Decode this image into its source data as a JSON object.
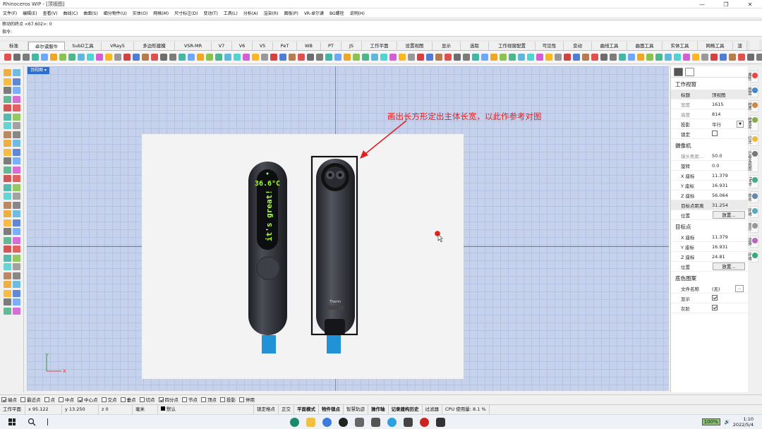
{
  "window": {
    "title": "Rhinoceros WIP - [顶视图]",
    "minimize": "—",
    "restore": "❐",
    "close": "✕"
  },
  "menu": [
    "文件(F)",
    "编辑(E)",
    "查看(V)",
    "曲线(C)",
    "曲面(S)",
    "细分物件(U)",
    "实体(O)",
    "网格(M)",
    "尺寸标注(D)",
    "变动(T)",
    "工具(L)",
    "分析(A)",
    "渲染(R)",
    "面板(P)",
    "VR-卓尔谟",
    "BG螺栓",
    "说明(H)"
  ],
  "command": {
    "history": "移动的终点 <67.602>: 0",
    "prompt": "指令:"
  },
  "tabs": [
    "标准",
    "卓尔谟服牛",
    "SubD工具",
    "VRay5",
    "多边形建模",
    "VSR-MR",
    "V7",
    "V6",
    "V5",
    "PeT",
    "WB",
    "PT",
    "JS",
    "工作平面",
    "设置视图",
    "显示",
    "选取",
    "工作视窗配置",
    "可见性",
    "变动",
    "曲线工具",
    "曲面工具",
    "实体工具",
    "网格工具",
    "渲"
  ],
  "viewport": {
    "label": "顶视图 ▾",
    "note": "画出长方形定出主体长宽，以此作参考对图"
  },
  "device": {
    "temp": "36.6°C",
    "message": "it's great!",
    "brand": "Therm"
  },
  "axes": {
    "x": "x",
    "y": "y"
  },
  "panel": {
    "viewport_section": "工作视窗",
    "viewport_rows": [
      {
        "k": "标题",
        "v": "顶视图"
      },
      {
        "k": "宽度",
        "v": "1615"
      },
      {
        "k": "高度",
        "v": "814"
      },
      {
        "k": "投影",
        "v": "平行"
      },
      {
        "k": "锁定",
        "v": ""
      }
    ],
    "camera_section": "摄像机",
    "camera_rows": [
      {
        "k": "镜头焦距...",
        "v": "50.0"
      },
      {
        "k": "旋转",
        "v": "0.0"
      },
      {
        "k": "X 座标",
        "v": "11.379"
      },
      {
        "k": "Y 座标",
        "v": "16.931"
      },
      {
        "k": "Z 座标",
        "v": "56.064"
      },
      {
        "k": "目标点距离",
        "v": "31.254"
      },
      {
        "k": "位置",
        "v": "放置..."
      }
    ],
    "target_section": "目标点",
    "target_rows": [
      {
        "k": "X 座标",
        "v": "11.379"
      },
      {
        "k": "Y 座标",
        "v": "16.931"
      },
      {
        "k": "Z 座标",
        "v": "24.81"
      },
      {
        "k": "位置",
        "v": "放置..."
      }
    ],
    "bg_section": "底色图案",
    "bg_rows": [
      {
        "k": "文件名称",
        "v": "(无)"
      },
      {
        "k": "显示",
        "v": ""
      },
      {
        "k": "灰阶",
        "v": ""
      }
    ],
    "ellipsis": "..."
  },
  "vtabs": [
    "属性",
    "图层",
    "材质",
    "材质库",
    "灯光",
    "已命名视图",
    "Help",
    "命名",
    "环境",
    "显示",
    "渲染",
    "环境"
  ],
  "osnaps": [
    {
      "label": "端点",
      "on": true
    },
    {
      "label": "最近点",
      "on": false
    },
    {
      "label": "点",
      "on": false
    },
    {
      "label": "中点",
      "on": false
    },
    {
      "label": "中心点",
      "on": true
    },
    {
      "label": "交点",
      "on": false
    },
    {
      "label": "垂点",
      "on": false
    },
    {
      "label": "切点",
      "on": false
    },
    {
      "label": "四分点",
      "on": true
    },
    {
      "label": "节点",
      "on": false
    },
    {
      "label": "顶点",
      "on": false
    },
    {
      "label": "投影",
      "on": false
    },
    {
      "label": "停用",
      "on": false
    }
  ],
  "status": {
    "plane": "工作平面",
    "x": "x 95.122",
    "y": "y 13.250",
    "z": "z 0",
    "unit": "毫米",
    "layer": "默认",
    "toggles": [
      "锁定格点",
      "正交",
      "平面模式",
      "物件锁点",
      "智慧轨迹",
      "操作轴",
      "记录建构历史",
      "过滤器"
    ],
    "bold_toggles": [
      "平面模式",
      "物件锁点",
      "操作轴",
      "记录建构历史"
    ],
    "cpu": "CPU 使用量: 8.1 %"
  },
  "taskbar": {
    "battery": "100%",
    "time": "1:10",
    "date": "2022/5/4",
    "search_icon": "search-icon"
  },
  "colors": {
    "accent": "#2a6fd0",
    "note": "#e02020",
    "grid_bg": "#c6d2ec"
  }
}
